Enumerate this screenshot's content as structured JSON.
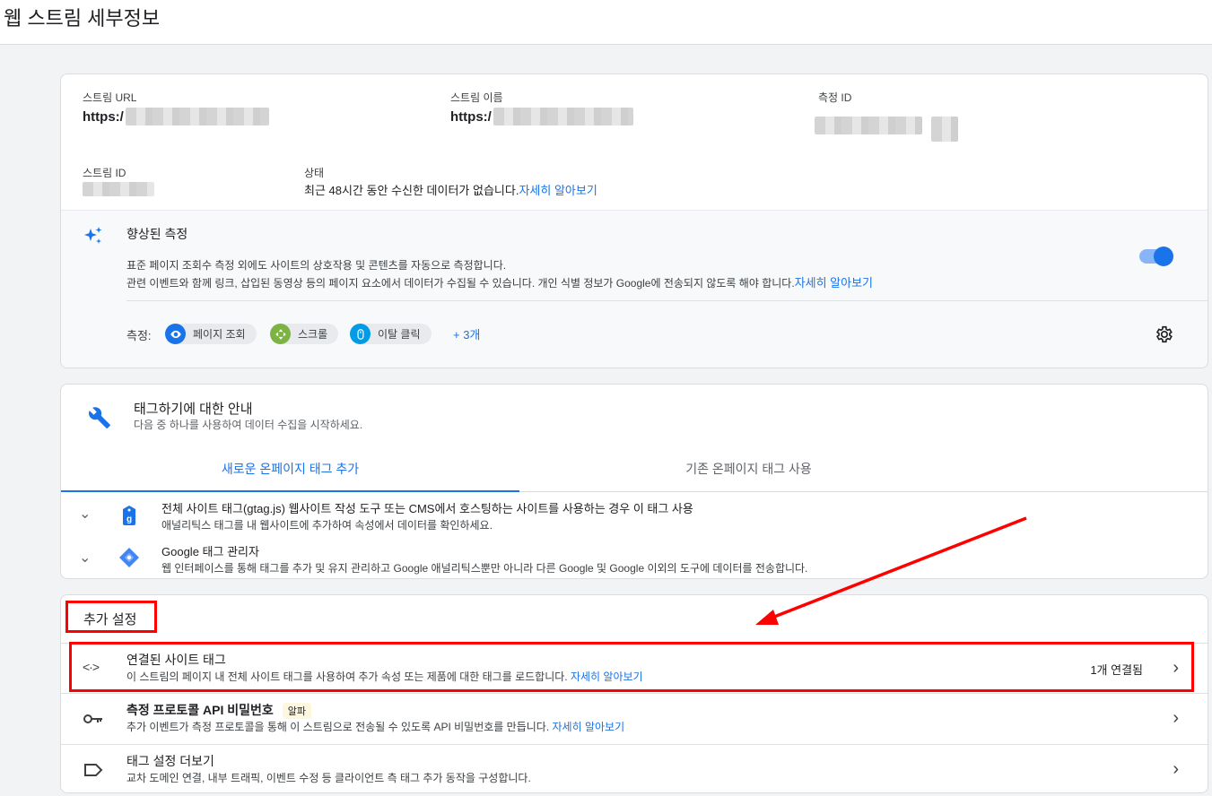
{
  "page_title": "웹 스트림 세부정보",
  "stream": {
    "url_label": "스트림 URL",
    "url_value": "https:/",
    "name_label": "스트림 이름",
    "name_value": "https:/",
    "measurement_id_label": "측정 ID",
    "stream_id_label": "스트림 ID",
    "status_label": "상태",
    "status_text": "최근 48시간 동안 수신한 데이터가 없습니다.",
    "status_link": "자세히 알아보기"
  },
  "enhanced": {
    "title": "향상된 측정",
    "desc1": "표준 페이지 조회수 측정 외에도 사이트의 상호작용 및 콘텐츠를 자동으로 측정합니다.",
    "desc2": "관련 이벤트와 함께 링크, 삽입된 동영상 등의 페이지 요소에서 데이터가 수집될 수 있습니다. 개인 식별 정보가 Google에 전송되지 않도록 해야 합니다.",
    "desc2_link": "자세히 알아보기",
    "toggle_on": true,
    "measure_label": "측정:",
    "chips": [
      {
        "label": "페이지 조회",
        "color": "#1a73e8",
        "icon": "eye-icon"
      },
      {
        "label": "스크롤",
        "color": "#7cb342",
        "icon": "scroll-icon"
      },
      {
        "label": "이탈 클릭",
        "color": "#039be5",
        "icon": "mouse-icon"
      }
    ],
    "more": "+ 3개"
  },
  "tagging": {
    "title": "태그하기에 대한 안내",
    "subtitle": "다음 중 하나를 사용하여 데이터 수집을 시작하세요.",
    "tabs": [
      "새로운 온페이지 태그 추가",
      "기존 온페이지 태그 사용"
    ],
    "items": [
      {
        "title": "전체 사이트 태그(gtag.js) 웹사이트 작성 도구 또는 CMS에서 호스팅하는 사이트를 사용하는 경우 이 태그 사용",
        "desc": "애널리틱스 태그를 내 웹사이트에 추가하여 속성에서 데이터를 확인하세요."
      },
      {
        "title": "Google 태그 관리자",
        "desc": "웹 인터페이스를 통해 태그를 추가 및 유지 관리하고 Google 애널리틱스뿐만 아니라 다른 Google 및 Google 이외의 도구에 데이터를 전송합니다."
      }
    ]
  },
  "additional": {
    "title": "추가 설정",
    "rows": [
      {
        "title": "연결된 사이트 태그",
        "desc": "이 스트림의 페이지 내 전체 사이트 태그를 사용하여 추가 속성 또는 제품에 대한 태그를 로드합니다. ",
        "link": "자세히 알아보기",
        "right": "1개 연결됨"
      },
      {
        "title": "측정 프로토콜 API 비밀번호",
        "badge": "알파",
        "desc": "추가 이벤트가 측정 프로토콜을 통해 이 스트림으로 전송될 수 있도록 API 비밀번호를 만듭니다. ",
        "link": "자세히 알아보기"
      },
      {
        "title": "태그 설정 더보기",
        "desc": "교차 도메인 연결, 내부 트래픽, 이벤트 수정 등 클라이언트 측 태그 추가 동작을 구성합니다."
      }
    ]
  }
}
